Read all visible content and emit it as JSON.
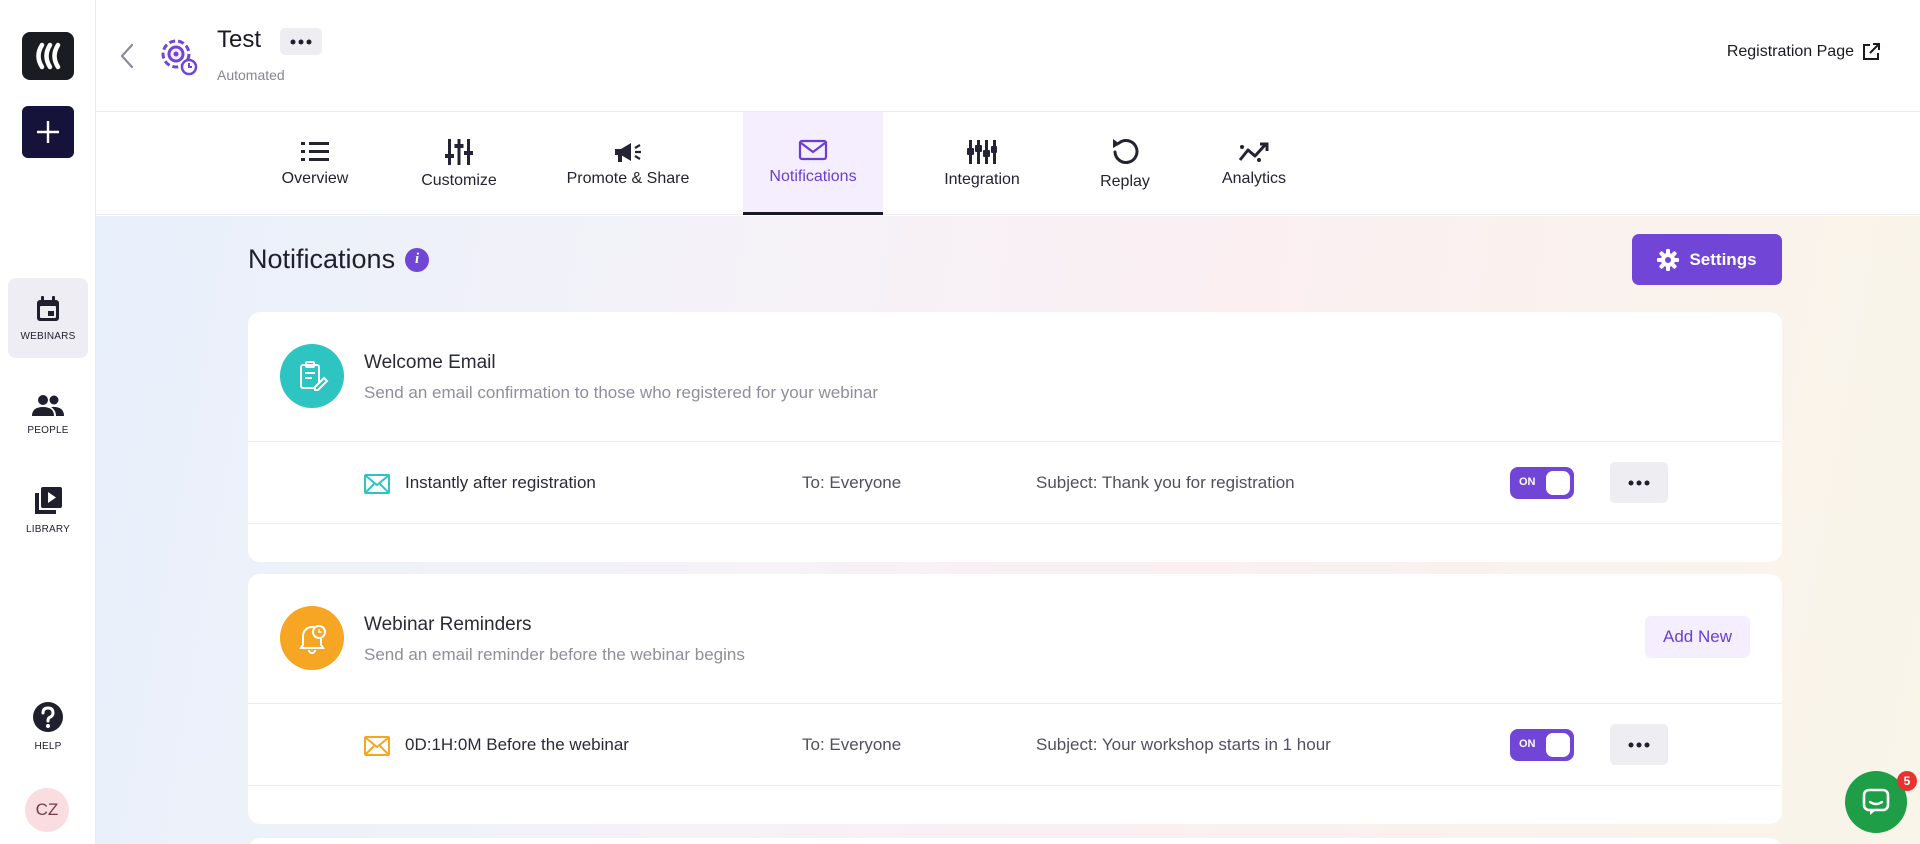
{
  "colors": {
    "accent": "#7145d6",
    "accent_light": "#f4eefe",
    "teal": "#2ec4c1",
    "orange": "#f6a623",
    "chat_green": "#1d9e47",
    "badge_red": "#e8322f"
  },
  "sidebar": {
    "items": [
      {
        "label": "WEBINARS",
        "icon": "calendar-icon",
        "active": true
      },
      {
        "label": "PEOPLE",
        "icon": "people-icon",
        "active": false
      },
      {
        "label": "LIBRARY",
        "icon": "library-icon",
        "active": false
      },
      {
        "label": "HELP",
        "icon": "help-icon",
        "active": false
      }
    ],
    "avatar_initials": "CZ"
  },
  "header": {
    "title": "Test",
    "subtitle": "Automated",
    "registration_link": "Registration Page"
  },
  "tabs": [
    {
      "label": "Overview",
      "icon": "list-icon"
    },
    {
      "label": "Customize",
      "icon": "sliders-icon"
    },
    {
      "label": "Promote & Share",
      "icon": "megaphone-icon"
    },
    {
      "label": "Notifications",
      "icon": "envelope-icon",
      "active": true
    },
    {
      "label": "Integration",
      "icon": "integration-icon"
    },
    {
      "label": "Replay",
      "icon": "replay-icon"
    },
    {
      "label": "Analytics",
      "icon": "analytics-icon"
    }
  ],
  "main": {
    "page_title": "Notifications",
    "info_glyph": "i",
    "settings_label": "Settings"
  },
  "cards": [
    {
      "title": "Welcome Email",
      "description": "Send an email confirmation to those who registered for your webinar",
      "icon": "clipboard-edit-icon",
      "rows": [
        {
          "timing": "Instantly after registration",
          "to": "To: Everyone",
          "subject": "Subject: Thank you for registration",
          "toggle": "ON"
        }
      ]
    },
    {
      "title": "Webinar Reminders",
      "description": "Send an email reminder before the webinar begins",
      "icon": "bell-clock-icon",
      "add_new_label": "Add New",
      "rows": [
        {
          "timing": "0D:1H:0M Before the webinar",
          "to": "To: Everyone",
          "subject": "Subject: Your workshop starts in 1 hour",
          "toggle": "ON"
        }
      ]
    }
  ],
  "chat": {
    "icon": "chat-icon",
    "badge_count": "5"
  }
}
